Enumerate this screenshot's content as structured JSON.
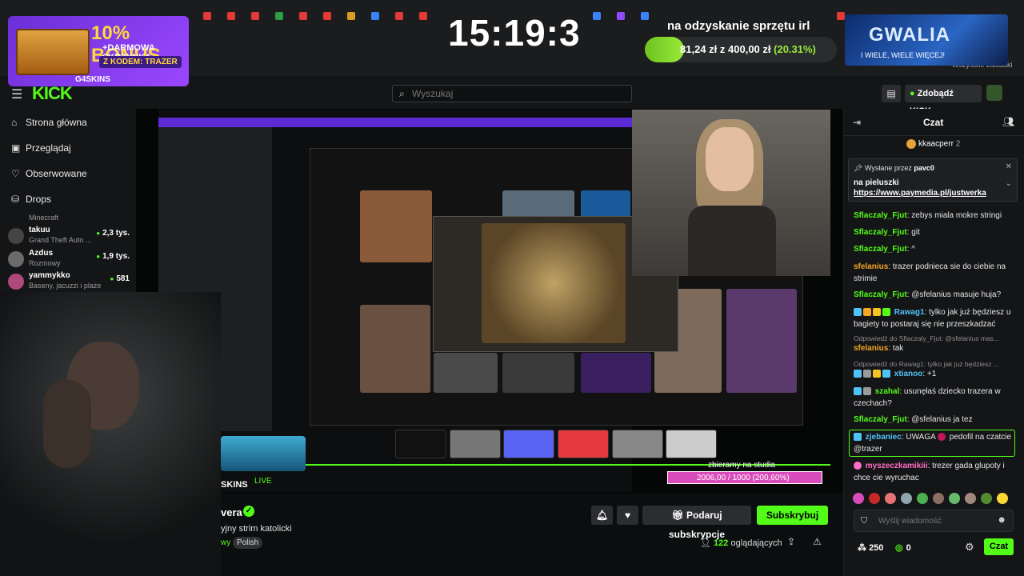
{
  "overlay": {
    "promo": {
      "headline": "10% BONUS",
      "line2": "+DARMOWA SKRZYNKA",
      "code": "Z KODEM: TRAZER",
      "brand": "G4SKINS"
    },
    "clock": "15:19:3",
    "goal": {
      "title": "na odzyskanie sprzętu irl",
      "current": "81,24 zł",
      "of": "z",
      "target": "400,00 zł",
      "percent_label": "(20.31%)",
      "progress": 0.2031
    },
    "gwalia": {
      "title": "GWALIA",
      "tagline": "I WIELE, WIELE WIĘCEJ!"
    },
    "bookmarks": "Wszystkie zakładki",
    "studio": {
      "label": "zbieramy na studia",
      "value": "2006,00 / 1000 (200,60%)"
    },
    "skins": "SKINS",
    "live": "LIVE"
  },
  "header": {
    "logo": "KICK",
    "search_placeholder": "Wyszukaj",
    "kicks_label": "Zdobądź KICKs"
  },
  "sidebar": {
    "nav": [
      {
        "label": "Strona główna",
        "icon": "home-icon"
      },
      {
        "label": "Przeglądaj",
        "icon": "browse-icon"
      },
      {
        "label": "Obserwowane",
        "icon": "heart-icon"
      },
      {
        "label": "Drops",
        "icon": "drops-icon"
      }
    ],
    "channels": [
      {
        "name": "",
        "category": "Minecraft",
        "viewers": ""
      },
      {
        "name": "takuu",
        "category": "Grand Theft Auto ...",
        "viewers": "2,3 tys."
      },
      {
        "name": "Azdus",
        "category": "Rozmowy",
        "viewers": "1,9 tys."
      },
      {
        "name": "yammykko",
        "category": "Baseny, jacuzzi i plaże",
        "viewers": "581"
      }
    ]
  },
  "stream": {
    "name": "vera",
    "title": "yjny strim katolicki",
    "category": "wy",
    "tag": "Polish",
    "subscribe_gift": "Podaruj subskrypcje",
    "subscribe": "Subskrybuj",
    "viewers_count": "122",
    "viewers_label": "oglądających"
  },
  "chat": {
    "title": "Czat",
    "top_gifter": {
      "name": "kkaacperr",
      "count": "2"
    },
    "pinned": {
      "by_label": "Wysłane przez",
      "by_user": "pavc0",
      "message": "na pieluszki",
      "link": "https://www.paymedia.pl/justwerka"
    },
    "messages": [
      {
        "user": "Sflaczaly_Fjut",
        "color": "#53fc18",
        "text": "zebys miala mokre stringi"
      },
      {
        "user": "Sflaczaly_Fjut",
        "color": "#53fc18",
        "text": "git"
      },
      {
        "user": "Sflaczaly_Fjut",
        "color": "#53fc18",
        "text": "^"
      },
      {
        "user": "sfelanius",
        "color": "#f5a623",
        "text": "trazer podnieca sie do ciebie na strimie"
      },
      {
        "user": "Sflaczaly_Fjut",
        "color": "#53fc18",
        "text": "@sfelanius masuje huja?"
      },
      {
        "user": "Rawag1",
        "color": "#4fc3f7",
        "text": "tylko jak już będziesz u bagiety to postaraj się nie przeszkadzać"
      },
      {
        "reply": "Odpowiedź do Sflaczaly_Fjut: @sfelanius mas..."
      },
      {
        "user": "sfelanius",
        "color": "#f5a623",
        "text": "tak"
      },
      {
        "reply": "Odpowiedź do Rawag1: tylko jak już będziesz ..."
      },
      {
        "user": "xtianoo",
        "color": "#4fc3f7",
        "text": "+1"
      },
      {
        "user": "szahal",
        "color": "#53fc18",
        "text": "usunęłaś dziecko trazera w czechach?"
      },
      {
        "user": "Sflaczaly_Fjut",
        "color": "#53fc18",
        "text": "@sfelanius ja tez"
      },
      {
        "user": "zjebaniec",
        "color": "#4fc3f7",
        "text": "UWAGA",
        "text2": "pedofil na czatcie @trazer"
      },
      {
        "user": "myszeczkamikiii",
        "color": "#ff6ec7",
        "text": "trezer gada glupoty i chce cie wyruchac"
      }
    ],
    "input_placeholder": "Wyślij wiadomość",
    "points": "250",
    "kicks": "0",
    "send_label": "Czat"
  }
}
